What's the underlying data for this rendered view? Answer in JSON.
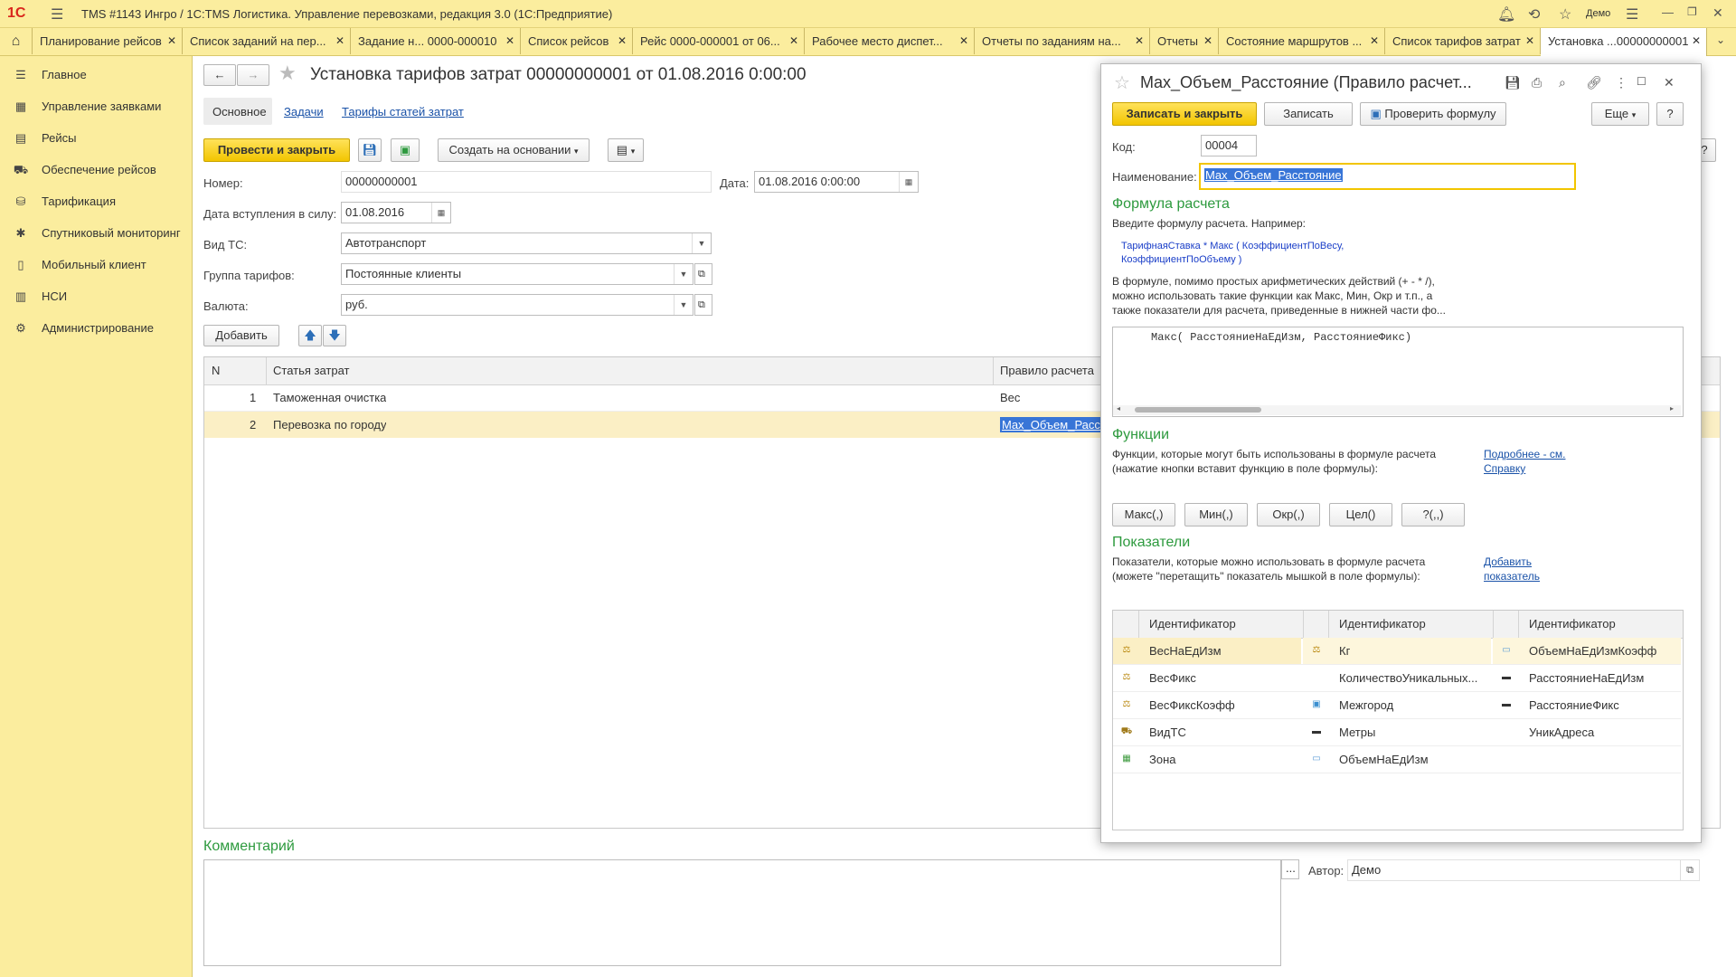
{
  "window": {
    "logo": "1С",
    "title": "TMS #1143 Ингро / 1С:TMS Логистика. Управление перевозками, редакция 3.0  (1С:Предприятие)",
    "user": "Демо"
  },
  "tabs": [
    {
      "label": "Планирование рейсов"
    },
    {
      "label": "Список заданий на пер..."
    },
    {
      "label": "Задание н...  0000-000010"
    },
    {
      "label": "Список рейсов"
    },
    {
      "label": "Рейс 0000-000001 от 06..."
    },
    {
      "label": "Рабочее место диспет..."
    },
    {
      "label": "Отчеты по заданиям на..."
    },
    {
      "label": "Отчеты"
    },
    {
      "label": "Состояние маршрутов ..."
    },
    {
      "label": "Список тарифов затрат"
    },
    {
      "label": "Установка ...00000000001"
    }
  ],
  "sidebar": {
    "items": [
      {
        "label": "Главное",
        "icon": "menu-icon"
      },
      {
        "label": "Управление заявками",
        "icon": "grid-icon"
      },
      {
        "label": "Рейсы",
        "icon": "calendar-icon"
      },
      {
        "label": "Обеспечение рейсов",
        "icon": "truck-icon"
      },
      {
        "label": "Тарификация",
        "icon": "coins-icon"
      },
      {
        "label": "Спутниковый мониторинг",
        "icon": "satellite-icon"
      },
      {
        "label": "Мобильный клиент",
        "icon": "phone-icon"
      },
      {
        "label": "НСИ",
        "icon": "book-icon"
      },
      {
        "label": "Администрирование",
        "icon": "gear-icon"
      }
    ]
  },
  "doc": {
    "title": "Установка тарифов затрат 00000000001 от 01.08.2016 0:00:00",
    "subtabs": {
      "main": "Основное",
      "tasks": "Задачи",
      "tariffs": "Тарифы статей затрат"
    },
    "toolbar": {
      "post_close": "Провести и закрыть",
      "create_based": "Создать на основании"
    },
    "fields": {
      "number_label": "Номер:",
      "number": "00000000001",
      "date_label": "Дата:",
      "date": "01.08.2016  0:00:00",
      "effective_label": "Дата вступления в силу:",
      "effective": "01.08.2016",
      "vehicle_label": "Вид ТС:",
      "vehicle": "Автотранспорт",
      "group_label": "Группа тарифов:",
      "group": "Постоянные клиенты",
      "currency_label": "Валюта:",
      "currency": "руб."
    },
    "add_button": "Добавить",
    "table": {
      "headers": {
        "n": "N",
        "item": "Статья затрат",
        "rule": "Правило расчета"
      },
      "rows": [
        {
          "n": "1",
          "item": "Таможенная очистка",
          "rule": "Вес"
        },
        {
          "n": "2",
          "item": "Перевозка по городу",
          "rule": "Max_Объем_Расст"
        }
      ]
    },
    "comment_title": "Комментарий",
    "author_label": "Автор:",
    "author": "Демо",
    "help": "?"
  },
  "modal": {
    "title": "Max_Объем_Расстояние (Правило расчет...",
    "buttons": {
      "save_close": "Записать и закрыть",
      "save": "Записать",
      "check": "Проверить формулу",
      "more": "Еще",
      "help": "?"
    },
    "code_label": "Код:",
    "code": "00004",
    "name_label": "Наименование:",
    "name": "Max_Объем_Расстояние",
    "formula_title": "Формула расчета",
    "formula_hint": "Введите формулу расчета. Например:",
    "formula_example_1": "ТарифнаяСтавка * Макс ( КоэффициентПоВесу,",
    "formula_example_2": "КоэффициентПоОбъему )",
    "formula_desc_1": "В формуле, помимо простых арифметических действий (+ - * /),",
    "formula_desc_2": "можно использовать такие функции как Макс, Мин, Окр и т.п., а",
    "formula_desc_3": "также показатели для расчета, приведенные в нижней части фо...",
    "formula": "Макс( РасстояниеНаЕдИзм, РасстояниеФикс)",
    "functions_title": "Функции",
    "functions_desc_1": "Функции, которые могут быть использованы в формуле расчета",
    "functions_desc_2": "(нажатие кнопки вставит функцию в поле формулы):",
    "functions_link_1": "Подробнее - см.",
    "functions_link_2": "Справку",
    "function_buttons": [
      "Макс(,)",
      "Мин(,)",
      "Окр(,)",
      "Цел()",
      "?(,,)"
    ],
    "indicators_title": "Показатели",
    "indicators_desc_1": "Показатели, которые можно использовать в формуле расчета",
    "indicators_desc_2": "(можете \"перетащить\" показатель мышкой в поле формулы):",
    "indicators_link_1": "Добавить",
    "indicators_link_2": "показатель",
    "indicators_header": "Идентификатор",
    "indicators": [
      [
        "ВесНаЕдИзм",
        "Кг",
        "ОбъемНаЕдИзмКоэфф"
      ],
      [
        "ВесФикс",
        "КоличествоУникальных...",
        "РасстояниеНаЕдИзм"
      ],
      [
        "ВесФиксКоэфф",
        "Межгород",
        "РасстояниеФикс"
      ],
      [
        "ВидТС",
        "Метры",
        "УникАдреса"
      ],
      [
        "Зона",
        "ОбъемНаЕдИзм",
        ""
      ]
    ],
    "indicator_icons": [
      [
        "scales-icon",
        "scales-icon",
        "box-icon"
      ],
      [
        "scales-icon",
        "",
        "ruler-icon"
      ],
      [
        "scales-icon",
        "map-icon",
        "ruler-icon"
      ],
      [
        "truck-icon",
        "ruler-icon",
        ""
      ],
      [
        "zone-icon",
        "box-icon",
        ""
      ]
    ]
  },
  "colors": {
    "accent_yellow": "#f2c500",
    "panel": "#fbed9e",
    "green_heading": "#2d9a3e",
    "link": "#1a52a8",
    "selection": "#3875d7"
  }
}
